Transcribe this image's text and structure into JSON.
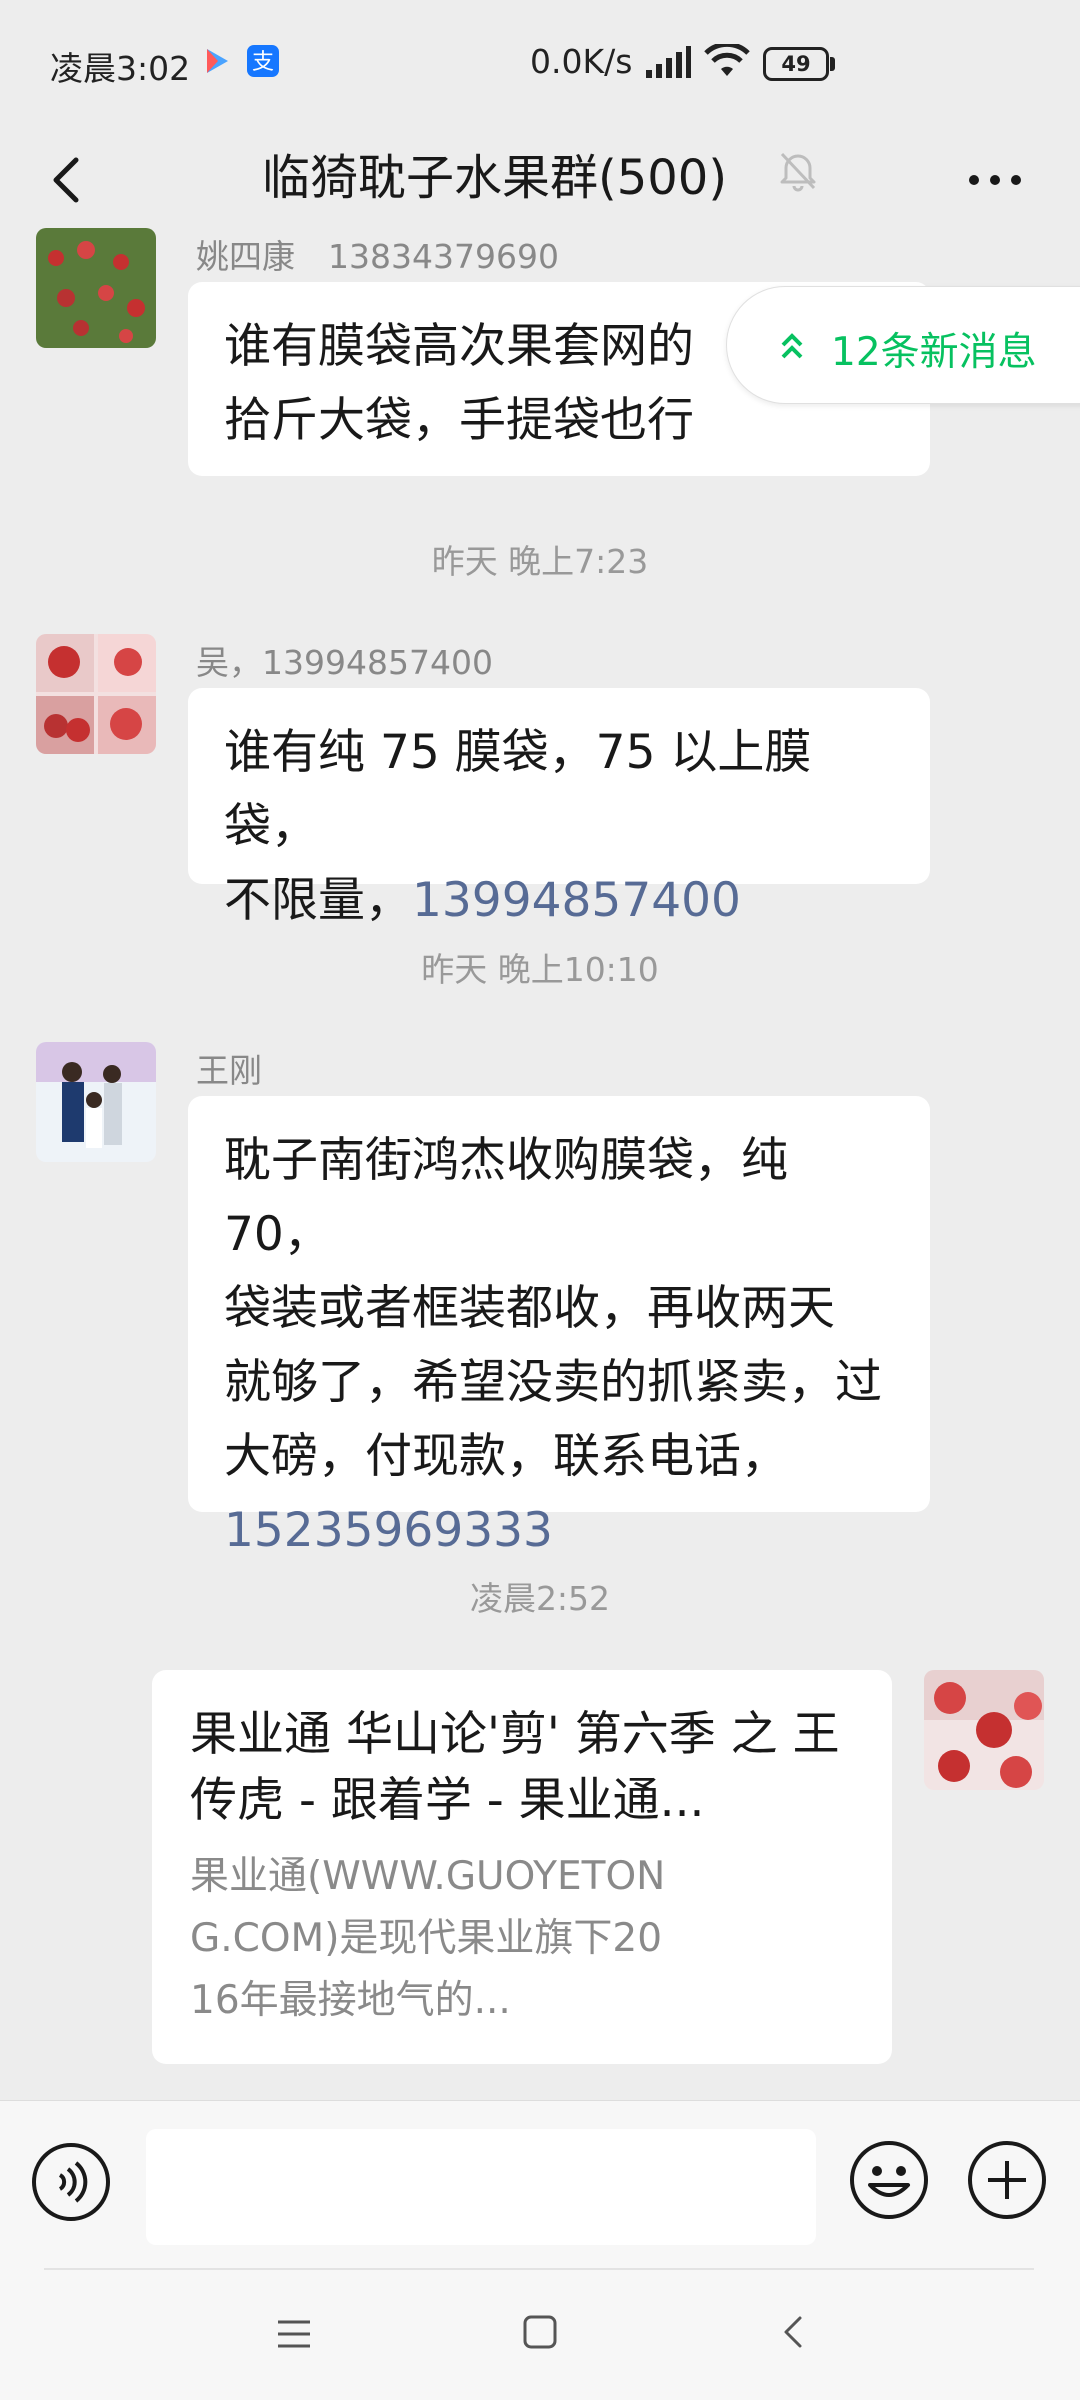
{
  "status_bar": {
    "time": "凌晨3:02",
    "network_speed": "0.0K/s",
    "battery": "49",
    "app_icons": [
      "video-app-icon",
      "alipay-icon"
    ]
  },
  "header": {
    "title": "临猗耽子水果群(500)",
    "icons": [
      "back-arrow-icon",
      "mute-bell-icon",
      "more-dots-icon"
    ]
  },
  "new_messages_pill": {
    "label": "12条新消息",
    "color": "#07c160"
  },
  "messages": [
    {
      "sender": "姚四康　13834379690",
      "text": "谁有膜袋高次果套网的\n拾斤大袋，手提袋也行"
    },
    {
      "timestamp": "昨天 晚上7:23"
    },
    {
      "sender": "吴，13994857400",
      "text_part1": "谁有纯 75 膜袋，75 以上膜袋，",
      "text_part2": "不限量，",
      "phone": "13994857400"
    },
    {
      "timestamp": "昨天 晚上10:10"
    },
    {
      "sender": "王刚",
      "text": "耽子南街鸿杰收购膜袋，纯 70，\n袋装或者框装都收，再收两天\n就够了，希望没卖的抓紧卖，过\n大磅，付现款，联系电话，",
      "phone": "15235969333"
    },
    {
      "timestamp": "凌晨2:52"
    },
    {
      "card_title": "果业通 华山论'剪' 第六季 之 王传虎 - 跟着学 - 果业通...",
      "card_desc": "果业通(WWW.GUOYETONG.COM)是现代果业旗下2016年最接地气的..."
    }
  ],
  "colors": {
    "background": "#ededed",
    "bubble": "#ffffff",
    "link": "#576b95",
    "accent": "#07c160"
  },
  "input_bar": {
    "icons": [
      "voice-icon",
      "emoji-icon",
      "plus-icon"
    ],
    "value": ""
  },
  "system_nav": {
    "icons": [
      "menu-icon",
      "home-icon",
      "back-icon"
    ]
  }
}
